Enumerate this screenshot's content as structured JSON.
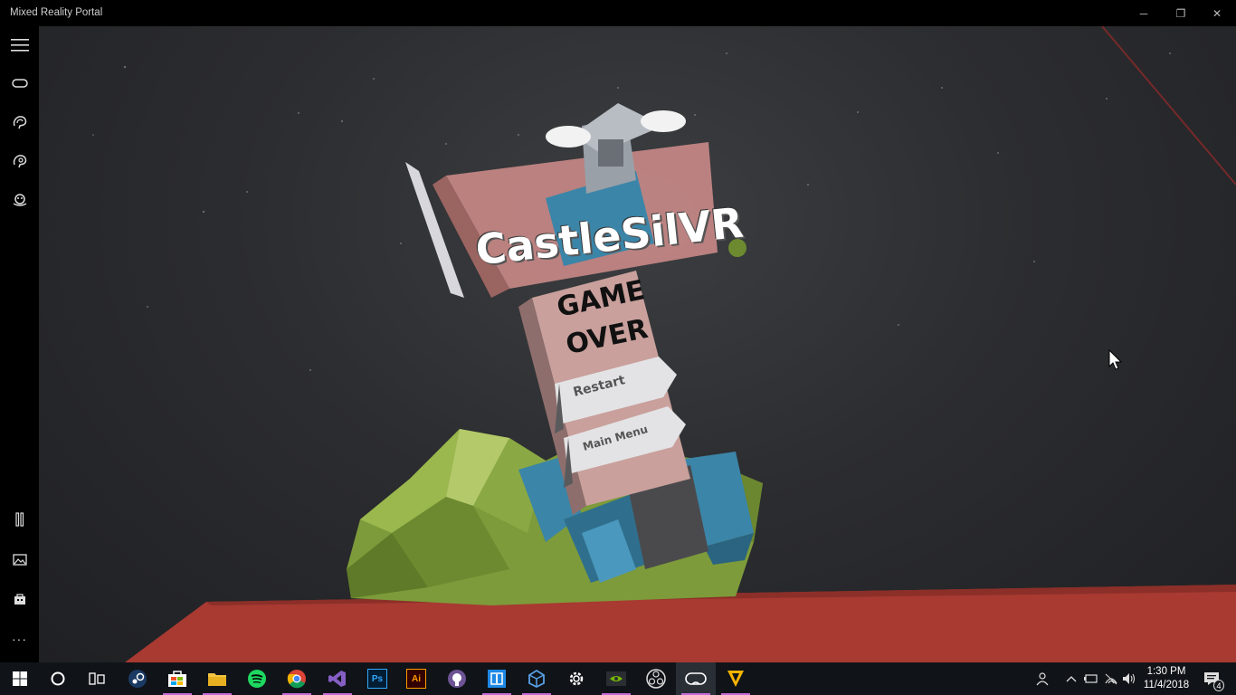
{
  "window": {
    "title": "Mixed Reality Portal",
    "controls": {
      "minimize": "─",
      "restore": "❐",
      "close": "✕"
    }
  },
  "sidebar": {
    "top_items": [
      "menu-icon",
      "headset-icon",
      "broadcast-icon",
      "hearing-icon",
      "mixed-reality-icon"
    ],
    "bottom_items": [
      "tools-icon",
      "photos-icon",
      "store-icon",
      "more-icon"
    ],
    "more_label": "···"
  },
  "scene": {
    "logo_text": "CastleSilVR",
    "sign_line1": "GAME",
    "sign_line2": "OVER",
    "restart_label": "Restart",
    "main_menu_label": "Main Menu"
  },
  "taskbar": {
    "apps": [
      "start",
      "cortana",
      "task-view",
      "steam",
      "store",
      "file-explorer",
      "spotify",
      "chrome",
      "visual-studio",
      "photoshop",
      "illustrator",
      "github",
      "app-blue",
      "unity",
      "settings",
      "nvidia",
      "obs",
      "mixed-reality-portal",
      "vectorworks"
    ],
    "photoshop_label": "Ps",
    "illustrator_label": "Ai",
    "time": "1:30 PM",
    "date": "11/4/2018",
    "notifications_count": "4"
  },
  "colors": {
    "taskbar_bg": "#101418",
    "sign_pink": "#c9a09c",
    "floor_red": "#a83a32",
    "rock_green": "#7d9b3a",
    "castle_blue": "#3b85a8",
    "active_underline": "#c56bd8"
  }
}
